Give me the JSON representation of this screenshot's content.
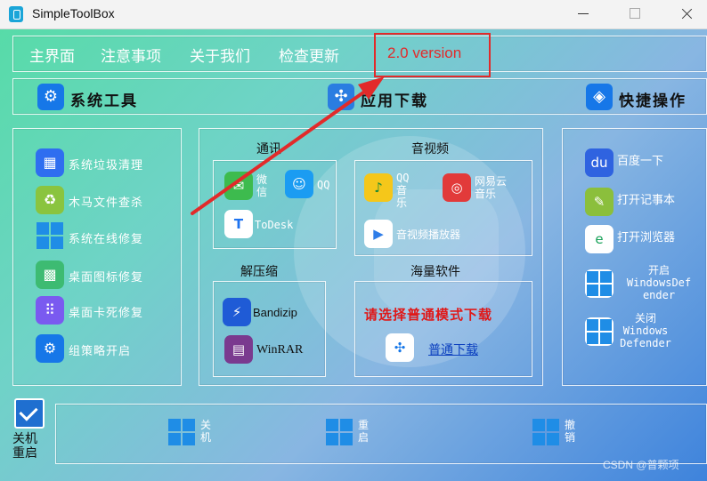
{
  "window": {
    "title": "SimpleToolBox",
    "controls": [
      "minimize-icon",
      "maximize-icon",
      "close-icon"
    ]
  },
  "menu": {
    "items": [
      {
        "label": "主界面"
      },
      {
        "label": "注意事项"
      },
      {
        "label": "关于我们"
      },
      {
        "label": "检查更新"
      }
    ],
    "version_annotation": "2.0 version"
  },
  "categories": [
    {
      "label": "系统工具",
      "icon": "gear-icon"
    },
    {
      "label": "应用下载",
      "icon": "app-store-icon"
    },
    {
      "label": "快捷操作",
      "icon": "shortcut-icon"
    }
  ],
  "system_tools": [
    {
      "label": "系统垃圾清理",
      "icon": "cleanup-icon"
    },
    {
      "label": "木马文件查杀",
      "icon": "recycle-icon"
    },
    {
      "label": "系统在线修复",
      "icon": "windows-icon"
    },
    {
      "label": "桌面图标修复",
      "icon": "creeper-icon"
    },
    {
      "label": "桌面卡死修复",
      "icon": "grid-icon"
    },
    {
      "label": "组策略开启",
      "icon": "gear-icon"
    }
  ],
  "downloads": {
    "comm": {
      "title": "通讯",
      "apps": [
        {
          "label": "微\n信",
          "icon": "wechat-icon"
        },
        {
          "label": "QQ",
          "icon": "qq-icon"
        },
        {
          "label": "ToDesk",
          "icon": "todesk-icon"
        }
      ]
    },
    "media": {
      "title": "音视频",
      "apps": [
        {
          "label": "QQ\n音\n乐",
          "icon": "qq-music-icon"
        },
        {
          "label": "网易云\n音乐",
          "icon": "netease-music-icon"
        },
        {
          "label": "音视频播放器",
          "icon": "play-icon"
        }
      ]
    },
    "archive": {
      "title": "解压缩",
      "apps": [
        {
          "label": "Bandizip",
          "icon": "bandizip-icon"
        },
        {
          "label": "WinRAR",
          "icon": "winrar-icon"
        }
      ]
    },
    "massive": {
      "title": "海量软件",
      "notice": "请选择普通模式下载",
      "link": "普通下载",
      "icon": "app-store-icon"
    }
  },
  "shortcuts": [
    {
      "label": "百度一下",
      "icon": "baidu-icon"
    },
    {
      "label": "打开记事本",
      "icon": "notepad-icon"
    },
    {
      "label": "打开浏览器",
      "icon": "edge-icon"
    },
    {
      "label": "开启\nWindowsDef\nender",
      "icon": "windows-icon"
    },
    {
      "label": "关闭\nWindows\nDefender",
      "icon": "windows-icon"
    }
  ],
  "footer": {
    "checkbox_label": "关机\n重启",
    "checked": true,
    "actions": [
      {
        "label": "关\n机",
        "icon": "windows-icon"
      },
      {
        "label": "重\n启",
        "icon": "windows-icon"
      },
      {
        "label": "撤\n销",
        "icon": "windows-icon"
      }
    ]
  },
  "watermark": "CSDN @普颗项",
  "colors": {
    "accent_blue": "#1677e8",
    "annotation_red": "#e22a2a",
    "notice_red": "#e01818",
    "link_blue": "#0b3fbf"
  }
}
